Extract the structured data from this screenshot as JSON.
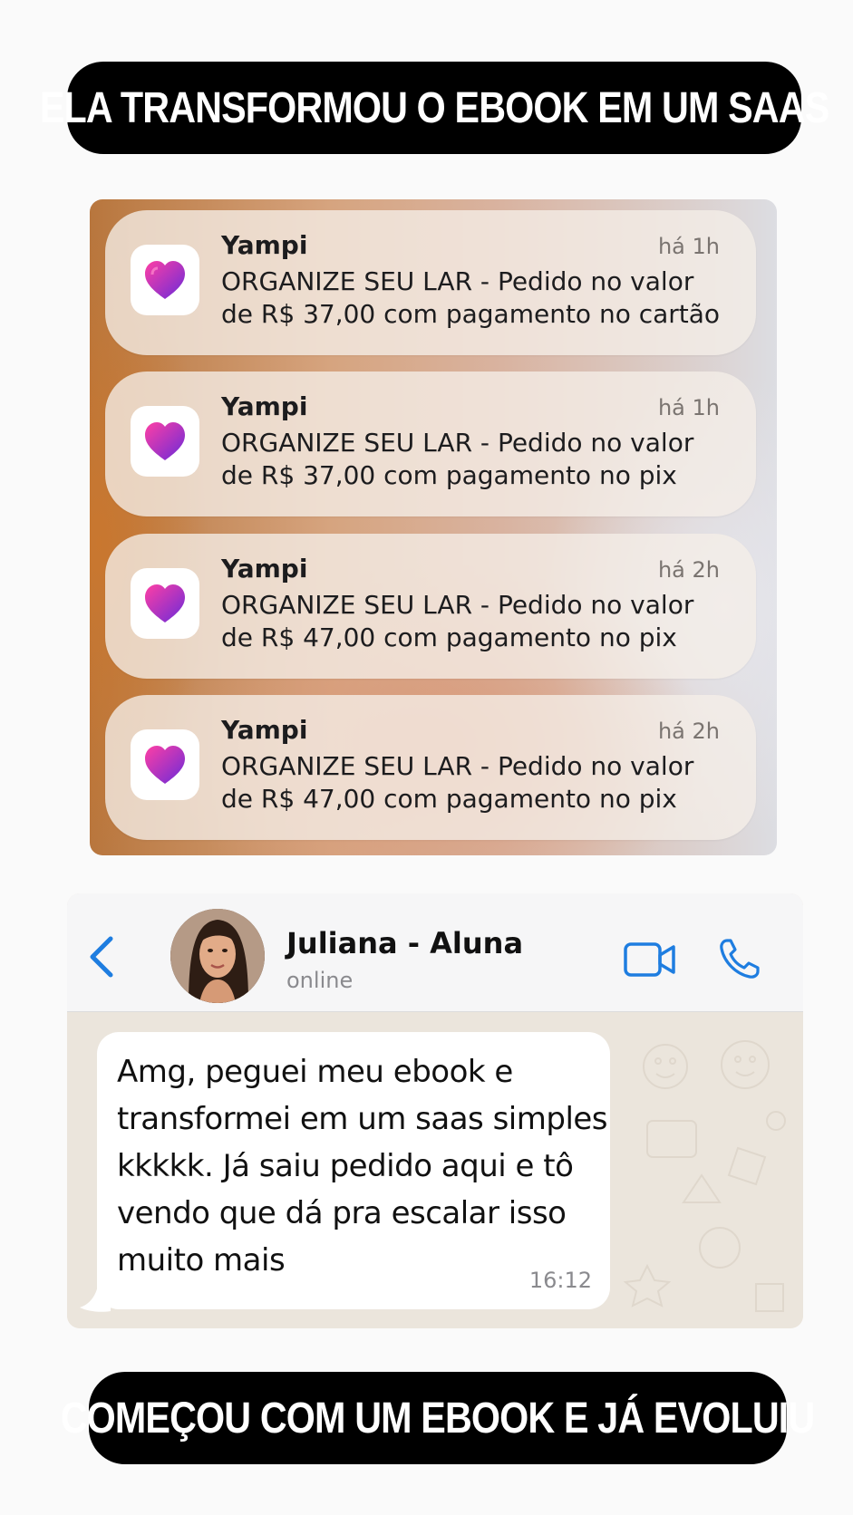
{
  "banner_top": "ELA TRANSFORMOU O EBOOK EM UM SAAS",
  "banner_bottom": "COMEÇOU COM UM EBOOK E JÁ EVOLUIU",
  "notifications": [
    {
      "app": "Yampi",
      "time": "há 1h",
      "line1": "ORGANIZE SEU LAR - Pedido no valor",
      "line2": "de R$ 37,00 com pagamento no cartão",
      "icon": "yampi-heart-icon"
    },
    {
      "app": "Yampi",
      "time": "há 1h",
      "line1": "ORGANIZE SEU LAR - Pedido no valor",
      "line2": "de R$ 37,00 com pagamento no pix",
      "icon": "yampi-heart-icon"
    },
    {
      "app": "Yampi",
      "time": "há 2h",
      "line1": "ORGANIZE SEU LAR - Pedido no valor",
      "line2": "de R$ 47,00 com pagamento no pix",
      "icon": "yampi-heart-icon"
    },
    {
      "app": "Yampi",
      "time": "há 2h",
      "line1": "ORGANIZE SEU LAR - Pedido no valor",
      "line2": "de R$ 47,00 com pagamento no pix",
      "icon": "yampi-heart-icon"
    }
  ],
  "chat": {
    "contact_name": "Juliana - Aluna",
    "status": "online",
    "message_lines": [
      "Amg, peguei meu ebook e",
      "transformei em um saas simples",
      "kkkkk. Já saiu pedido aqui e tô",
      "vendo que dá pra escalar isso",
      "muito mais"
    ],
    "message_time": "16:12",
    "icons": {
      "back": "chevron-left-icon",
      "video": "video-camera-icon",
      "call": "phone-icon"
    }
  },
  "colors": {
    "banner_bg": "#000000",
    "banner_text": "#ffffff",
    "accent_blue": "#1e7de0",
    "yampi_pink": "#d6249f",
    "yampi_purple": "#7b2ff7"
  }
}
